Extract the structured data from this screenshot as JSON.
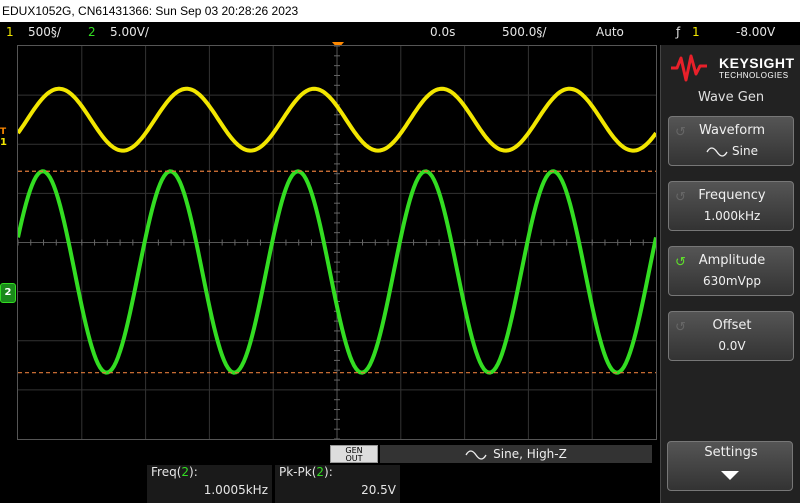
{
  "title_bar": {
    "text": "EDUX1052G, CN61431366: Sun Sep 03 20:28:26 2023"
  },
  "status": {
    "ch1_num": "1",
    "ch1_scale": "500§/",
    "ch2_num": "2",
    "ch2_scale": "5.00V/",
    "delay": "0.0s",
    "timebase": "500.0§/",
    "trigger_mode": "Auto",
    "trigger_icon": "ƒ",
    "trigger_ch": "1",
    "trigger_level": "-8.00V"
  },
  "screen": {
    "ch1_marker": "1",
    "ch2_marker": "2",
    "ch1_trig_label": "T"
  },
  "brand": {
    "name": "KEYSIGHT",
    "sub": "TECHNOLOGIES"
  },
  "menu": {
    "title": "Wave Gen",
    "softkeys": [
      {
        "label": "Waveform",
        "value": "Sine",
        "value_icon": "sine-wave-icon",
        "active": false
      },
      {
        "label": "Frequency",
        "value": "1.000kHz",
        "active": false
      },
      {
        "label": "Amplitude",
        "value": "630mVpp",
        "active": true
      },
      {
        "label": "Offset",
        "value": "0.0V",
        "active": false
      }
    ],
    "settings_label": "Settings"
  },
  "wavegen_bar": {
    "badge_line1": "GEN",
    "badge_line2": "OUT",
    "text": "Sine, High-Z"
  },
  "measurements": [
    {
      "label": "Freq(",
      "ch": "2",
      "label_end": "):",
      "value": "1.0005kHz"
    },
    {
      "label": "Pk-Pk(",
      "ch": "2",
      "label_end": "):",
      "value": "20.5V"
    }
  ],
  "colors": {
    "ch1": "#f2e600",
    "ch2": "#33dd22",
    "trigger": "#ff8800",
    "active_knob": "#5fe02a"
  },
  "waves": {
    "ch1": {
      "cycles": 5,
      "peak_to_peak_divisions": 1.26,
      "center_division": 1.5
    },
    "ch2": {
      "cycles": 5,
      "peak_to_peak_divisions": 4.1,
      "center_division": 4.6
    }
  }
}
